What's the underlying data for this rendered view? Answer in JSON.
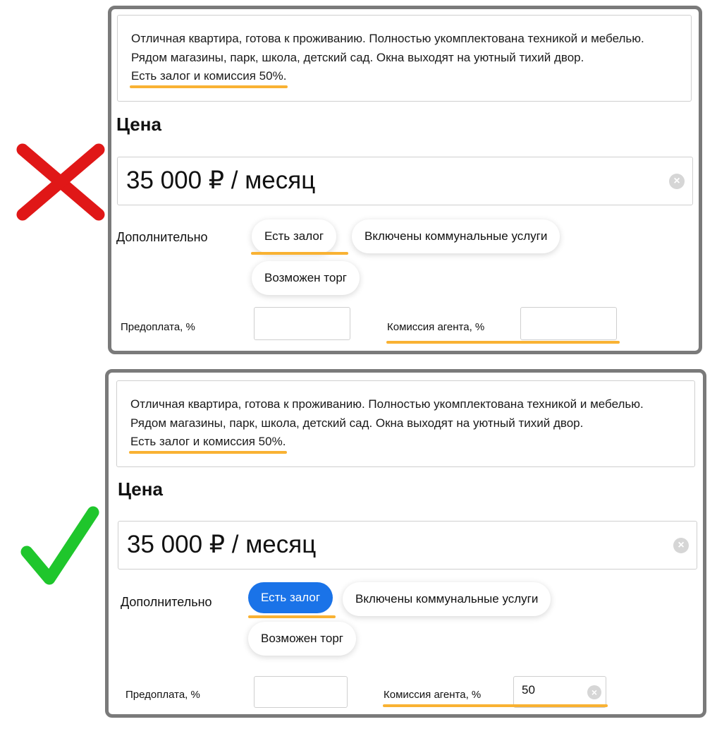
{
  "description": {
    "text": "Отличная квартира, готова к проживанию. Полностью укомплектована техникой и мебелью. Рядом магазины, парк, школа, детский сад. Окна выходят на уютный тихий двор. ",
    "highlight": "Есть залог и комиссия 50%."
  },
  "price": {
    "heading": "Цена",
    "value": "35 000 ₽ / месяц",
    "clear_icon": "×"
  },
  "extras": {
    "label": "Дополнительно",
    "chips": [
      "Есть залог",
      "Включены коммунальные услуги",
      "Возможен торг"
    ]
  },
  "prepayment": {
    "label": "Предоплата, %",
    "value": ""
  },
  "commission": {
    "label": "Комиссия агента, %"
  },
  "bad_example": {
    "commission_value": "",
    "deposit_selected": false
  },
  "good_example": {
    "commission_value": "50",
    "deposit_selected": true
  },
  "colors": {
    "underline": "#f9b233",
    "chip_active": "#1a73e8",
    "cross": "#e01717",
    "check": "#1fc62c"
  }
}
